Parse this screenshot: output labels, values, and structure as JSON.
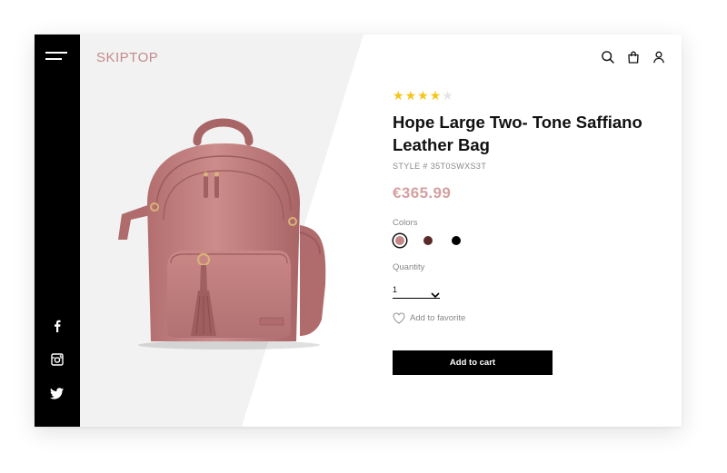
{
  "brand": {
    "name": "SKIPTOP"
  },
  "header": {
    "icons": [
      "search-icon",
      "bag-icon",
      "user-icon"
    ]
  },
  "sidebar": {
    "social": [
      "facebook-icon",
      "instagram-icon",
      "twitter-icon"
    ]
  },
  "product": {
    "rating": 4,
    "rating_max": 5,
    "title": "Hope Large Two- Tone Saffiano Leather Bag",
    "style": "STYLE # 35T0SWXS3T",
    "price": "€365.99",
    "colors_label": "Colors",
    "colors": [
      "#c48888",
      "#5a2b28",
      "#000000"
    ],
    "selected_color_index": 0,
    "quantity_label": "Quantity",
    "quantity_value": "1",
    "favorite_label": "Add to favorite",
    "add_to_cart_label": "Add to cart"
  },
  "theme": {
    "accent": "#d4a0a0",
    "brand_color": "#c48a8a",
    "star_color": "#f5c518",
    "panel_gray": "#f2f2f2"
  }
}
